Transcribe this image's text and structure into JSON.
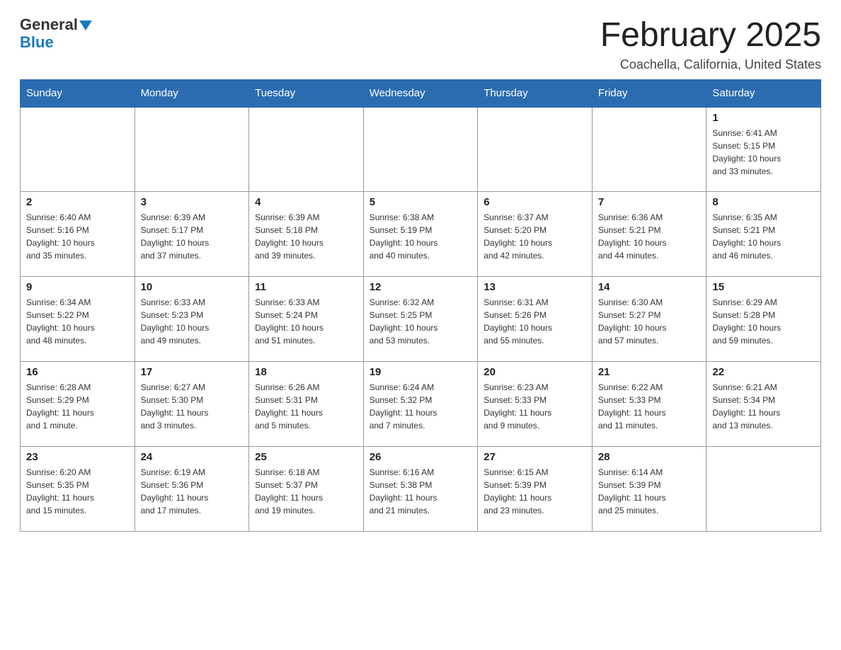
{
  "logo": {
    "text_general": "General",
    "text_blue": "Blue",
    "triangle_label": "logo-triangle"
  },
  "header": {
    "title": "February 2025",
    "subtitle": "Coachella, California, United States"
  },
  "weekdays": [
    "Sunday",
    "Monday",
    "Tuesday",
    "Wednesday",
    "Thursday",
    "Friday",
    "Saturday"
  ],
  "weeks": [
    [
      {
        "day": "",
        "info": ""
      },
      {
        "day": "",
        "info": ""
      },
      {
        "day": "",
        "info": ""
      },
      {
        "day": "",
        "info": ""
      },
      {
        "day": "",
        "info": ""
      },
      {
        "day": "",
        "info": ""
      },
      {
        "day": "1",
        "info": "Sunrise: 6:41 AM\nSunset: 5:15 PM\nDaylight: 10 hours\nand 33 minutes."
      }
    ],
    [
      {
        "day": "2",
        "info": "Sunrise: 6:40 AM\nSunset: 5:16 PM\nDaylight: 10 hours\nand 35 minutes."
      },
      {
        "day": "3",
        "info": "Sunrise: 6:39 AM\nSunset: 5:17 PM\nDaylight: 10 hours\nand 37 minutes."
      },
      {
        "day": "4",
        "info": "Sunrise: 6:39 AM\nSunset: 5:18 PM\nDaylight: 10 hours\nand 39 minutes."
      },
      {
        "day": "5",
        "info": "Sunrise: 6:38 AM\nSunset: 5:19 PM\nDaylight: 10 hours\nand 40 minutes."
      },
      {
        "day": "6",
        "info": "Sunrise: 6:37 AM\nSunset: 5:20 PM\nDaylight: 10 hours\nand 42 minutes."
      },
      {
        "day": "7",
        "info": "Sunrise: 6:36 AM\nSunset: 5:21 PM\nDaylight: 10 hours\nand 44 minutes."
      },
      {
        "day": "8",
        "info": "Sunrise: 6:35 AM\nSunset: 5:21 PM\nDaylight: 10 hours\nand 46 minutes."
      }
    ],
    [
      {
        "day": "9",
        "info": "Sunrise: 6:34 AM\nSunset: 5:22 PM\nDaylight: 10 hours\nand 48 minutes."
      },
      {
        "day": "10",
        "info": "Sunrise: 6:33 AM\nSunset: 5:23 PM\nDaylight: 10 hours\nand 49 minutes."
      },
      {
        "day": "11",
        "info": "Sunrise: 6:33 AM\nSunset: 5:24 PM\nDaylight: 10 hours\nand 51 minutes."
      },
      {
        "day": "12",
        "info": "Sunrise: 6:32 AM\nSunset: 5:25 PM\nDaylight: 10 hours\nand 53 minutes."
      },
      {
        "day": "13",
        "info": "Sunrise: 6:31 AM\nSunset: 5:26 PM\nDaylight: 10 hours\nand 55 minutes."
      },
      {
        "day": "14",
        "info": "Sunrise: 6:30 AM\nSunset: 5:27 PM\nDaylight: 10 hours\nand 57 minutes."
      },
      {
        "day": "15",
        "info": "Sunrise: 6:29 AM\nSunset: 5:28 PM\nDaylight: 10 hours\nand 59 minutes."
      }
    ],
    [
      {
        "day": "16",
        "info": "Sunrise: 6:28 AM\nSunset: 5:29 PM\nDaylight: 11 hours\nand 1 minute."
      },
      {
        "day": "17",
        "info": "Sunrise: 6:27 AM\nSunset: 5:30 PM\nDaylight: 11 hours\nand 3 minutes."
      },
      {
        "day": "18",
        "info": "Sunrise: 6:26 AM\nSunset: 5:31 PM\nDaylight: 11 hours\nand 5 minutes."
      },
      {
        "day": "19",
        "info": "Sunrise: 6:24 AM\nSunset: 5:32 PM\nDaylight: 11 hours\nand 7 minutes."
      },
      {
        "day": "20",
        "info": "Sunrise: 6:23 AM\nSunset: 5:33 PM\nDaylight: 11 hours\nand 9 minutes."
      },
      {
        "day": "21",
        "info": "Sunrise: 6:22 AM\nSunset: 5:33 PM\nDaylight: 11 hours\nand 11 minutes."
      },
      {
        "day": "22",
        "info": "Sunrise: 6:21 AM\nSunset: 5:34 PM\nDaylight: 11 hours\nand 13 minutes."
      }
    ],
    [
      {
        "day": "23",
        "info": "Sunrise: 6:20 AM\nSunset: 5:35 PM\nDaylight: 11 hours\nand 15 minutes."
      },
      {
        "day": "24",
        "info": "Sunrise: 6:19 AM\nSunset: 5:36 PM\nDaylight: 11 hours\nand 17 minutes."
      },
      {
        "day": "25",
        "info": "Sunrise: 6:18 AM\nSunset: 5:37 PM\nDaylight: 11 hours\nand 19 minutes."
      },
      {
        "day": "26",
        "info": "Sunrise: 6:16 AM\nSunset: 5:38 PM\nDaylight: 11 hours\nand 21 minutes."
      },
      {
        "day": "27",
        "info": "Sunrise: 6:15 AM\nSunset: 5:39 PM\nDaylight: 11 hours\nand 23 minutes."
      },
      {
        "day": "28",
        "info": "Sunrise: 6:14 AM\nSunset: 5:39 PM\nDaylight: 11 hours\nand 25 minutes."
      },
      {
        "day": "",
        "info": ""
      }
    ]
  ]
}
